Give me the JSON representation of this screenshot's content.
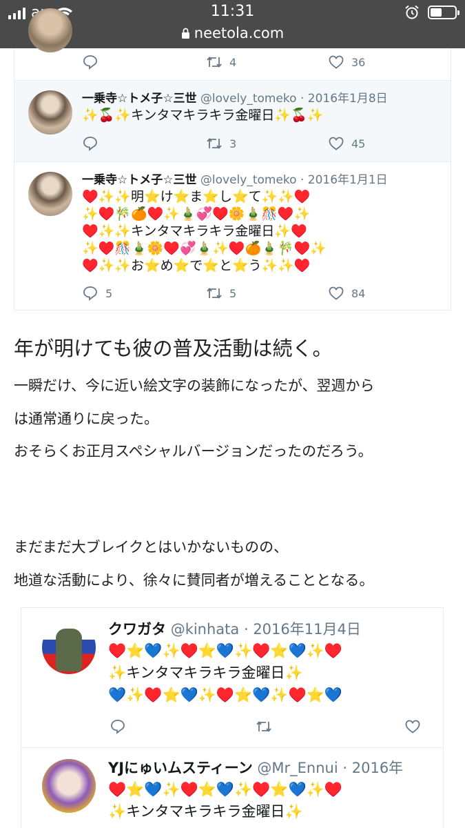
{
  "status_bar": {
    "carrier": "au",
    "time": "11:31",
    "url": "neetola.com"
  },
  "tweets_top": {
    "partial": {
      "replies": "",
      "retweets": "4",
      "likes": "36"
    },
    "items": [
      {
        "name": "一乗寺☆トメ子☆三世",
        "handle": "@lovely_tomeko",
        "date": "· 2016年1月8日",
        "lines": [
          "✨🍒✨キンタマキラキラ金曜日✨🍒✨"
        ],
        "replies": "",
        "retweets": "3",
        "likes": "45"
      },
      {
        "name": "一乗寺☆トメ子☆三世",
        "handle": "@lovely_tomeko",
        "date": "· 2016年1月1日",
        "lines": [
          "♥️✨✨明⭐️け⭐️ま⭐️し⭐️て✨✨♥️",
          "✨♥️🎋🍊♥️✨🎍💞♥️🌼🎍🎊♥️✨",
          "♥️✨✨キンタマキラキラ金曜日✨♥️",
          "✨♥️🎊🎍🌼♥️💞🎍✨♥️🍊🎍🎋♥️✨",
          "♥️✨✨お⭐️め⭐️で⭐️と⭐️う✨✨♥️"
        ],
        "replies": "5",
        "retweets": "5",
        "likes": "84"
      }
    ]
  },
  "article": {
    "heading": "年が明けても彼の普及活動は続く。",
    "para1_line1": "一瞬だけ、今に近い絵文字の装飾になったが、翌週から",
    "para1_line2": "は通常通りに戻った。",
    "para1_line3": "おそらくお正月スペシャルバージョンだったのだろう。",
    "para2_line1": "まだまだ大ブレイクとはいかないものの、",
    "para2_line2": "地道な活動により、徐々に賛同者が増えることとなる。"
  },
  "tweets_bottom": {
    "items": [
      {
        "name": "クワガタ",
        "handle": "@kinhata",
        "date": "· 2016年11月4日",
        "lines": [
          "♥️⭐️💙✨♥️⭐️💙✨♥️⭐️💙✨♥️",
          "✨キンタマキラキラ金曜日✨",
          "💙✨♥️⭐️💙✨♥️⭐️💙✨♥️⭐️💙"
        ]
      },
      {
        "name": "YJにゅいムスティーン",
        "handle": "@Mr_Ennui",
        "date": "· 2016年",
        "lines": [
          "♥️⭐️💙✨♥️⭐️💙✨♥️⭐️💙✨♥️",
          "✨キンタマキラキラ金曜日✨"
        ]
      }
    ]
  },
  "icons": [
    "reply-icon",
    "retweet-icon",
    "like-icon",
    "lock-icon",
    "wifi-icon",
    "alarm-icon",
    "battery-icon"
  ]
}
